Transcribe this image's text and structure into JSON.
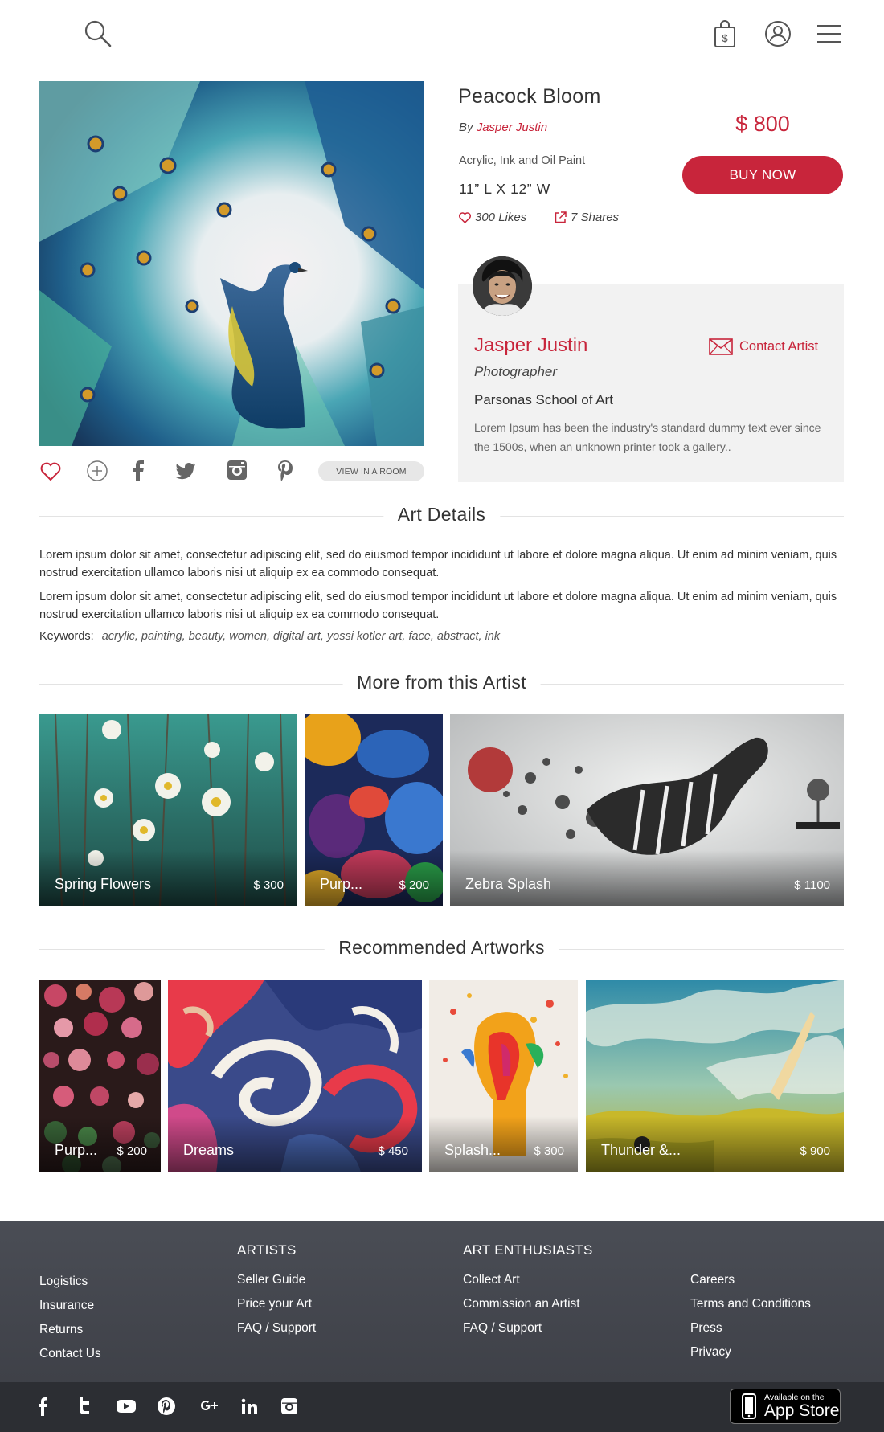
{
  "header": {
    "icons": [
      "search-icon",
      "shopping-bag-icon",
      "user-icon",
      "menu-icon"
    ]
  },
  "artwork": {
    "title": "Peacock Bloom",
    "by_prefix": "By",
    "artist": "Jasper Justin",
    "medium": "Acrylic, Ink and Oil Paint",
    "size": "11” L  X  12” W",
    "likes": "300 Likes",
    "shares": "7 Shares",
    "price": "$ 800",
    "buy_label": "BUY NOW",
    "view_in_room": "VIEW IN A ROOM"
  },
  "artist_card": {
    "name": "Jasper Justin",
    "contact_label": "Contact Artist",
    "role": "Photographer",
    "school": "Parsonas School of Art",
    "bio": "Lorem Ipsum has been the industry's standard dummy text ever since the 1500s, when an unknown printer took a gallery.."
  },
  "details": {
    "heading": "Art Details",
    "paragraphs": [
      "Lorem ipsum dolor sit amet, consectetur adipiscing elit, sed do eiusmod tempor incididunt ut labore et dolore magna aliqua. Ut enim ad minim veniam, quis nostrud exercitation ullamco laboris nisi ut aliquip ex ea commodo consequat.",
      "Lorem ipsum dolor sit amet, consectetur adipiscing elit, sed do eiusmod tempor incididunt ut labore et dolore magna aliqua. Ut enim ad minim veniam, quis nostrud exercitation ullamco laboris nisi ut aliquip ex ea commodo consequat."
    ],
    "keywords_label": "Keywords:",
    "keywords": "acrylic, painting, beauty, women, digital art, yossi kotler art, face, abstract, ink"
  },
  "more_from_artist": {
    "heading": "More from this Artist",
    "items": [
      {
        "name": "Spring Flowers",
        "price": "$ 300"
      },
      {
        "name": "Purp...",
        "price": "$ 200"
      },
      {
        "name": "Zebra Splash",
        "price": "$ 1100"
      }
    ]
  },
  "recommended": {
    "heading": "Recommended Artworks",
    "items": [
      {
        "name": "Purp...",
        "price": "$ 200"
      },
      {
        "name": "Dreams",
        "price": "$ 450"
      },
      {
        "name": "Splash...",
        "price": "$ 300"
      },
      {
        "name": "Thunder &...",
        "price": "$ 900"
      }
    ]
  },
  "footer": {
    "col1": {
      "links": [
        "Logistics",
        "Insurance",
        "Returns",
        "Contact Us"
      ]
    },
    "col2": {
      "heading": "ARTISTS",
      "links": [
        "Seller Guide",
        "Price your Art",
        "FAQ / Support"
      ]
    },
    "col3": {
      "heading": "ART ENTHUSIASTS",
      "links": [
        "Collect Art",
        "Commission an Artist",
        "FAQ / Support"
      ]
    },
    "col4": {
      "links": [
        "Careers",
        "Terms and Conditions",
        "Press",
        "Privacy"
      ]
    },
    "social_icons": [
      "facebook-icon",
      "twitter-icon",
      "youtube-icon",
      "pinterest-icon",
      "google-plus-icon",
      "linkedin-icon",
      "instagram-icon"
    ],
    "appstore_line1": "Available on the",
    "appstore_line2": "App Store"
  },
  "colors": {
    "accent": "#c8253b",
    "footer_bg": "#43464d",
    "card_bg": "#f2f2f2"
  }
}
